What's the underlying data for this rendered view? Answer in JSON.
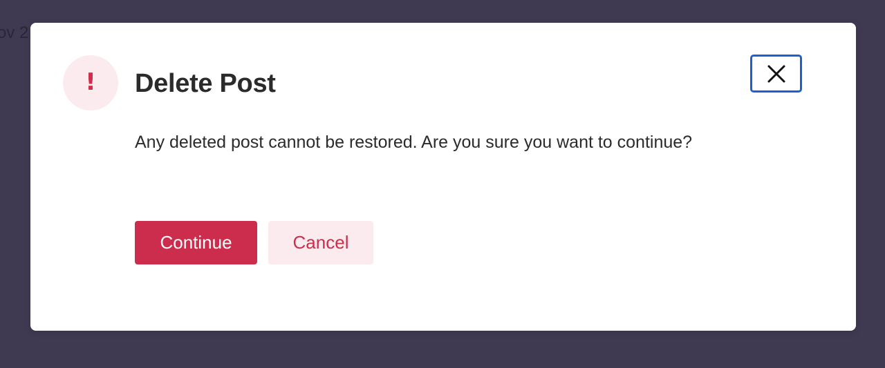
{
  "background": {
    "partial_text": "ov 2"
  },
  "dialog": {
    "title": "Delete Post",
    "alert_mark": "!",
    "message": "Any deleted post cannot be restored. Are you sure you want to continue?",
    "close_icon": "close-icon",
    "continue_label": "Continue",
    "cancel_label": "Cancel"
  },
  "colors": {
    "primary": "#cd2d4c",
    "primary_soft": "#fbebee",
    "focus_ring": "#1b5fd1",
    "backdrop": "#3f3a52",
    "text": "#2b2b2b"
  }
}
